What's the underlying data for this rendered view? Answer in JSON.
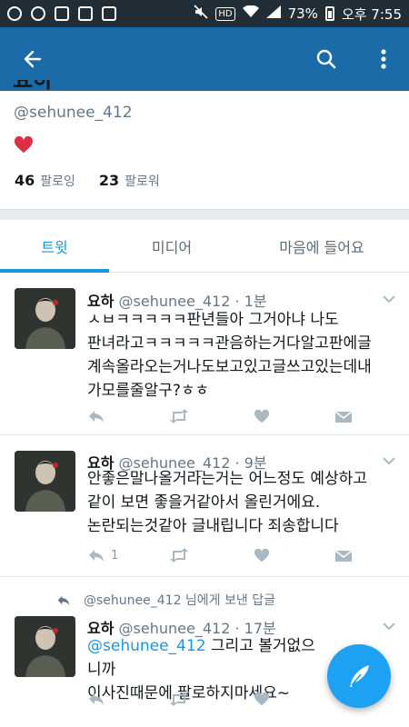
{
  "status_bar": {
    "battery": "73%",
    "time": "오후 7:55",
    "hd": "HD"
  },
  "profile": {
    "name_cut": "요하",
    "handle": "@sehunee_412",
    "following_count": "46",
    "following_label": "팔로잉",
    "followers_count": "23",
    "followers_label": "팔로워"
  },
  "tabs": [
    {
      "label": "트윗",
      "active": true
    },
    {
      "label": "미디어",
      "active": false
    },
    {
      "label": "마음에 들어요",
      "active": false
    }
  ],
  "tweets": [
    {
      "name": "요하",
      "meta": "@sehunee_412 · 1분",
      "lines": [
        "ㅅㅂㅋㅋㅋㅋㅋ판년들아 그거아냐 나도",
        "판녀라고ㅋㅋㅋㅋㅋ관음하는거다알고판에글",
        "계속올라오는거나도보고있고글쓰고있는데내",
        "가모를줄알구?ㅎㅎ"
      ],
      "reply_count": ""
    },
    {
      "name": "요하",
      "meta": "@sehunee_412 · 9분",
      "lines": [
        "안좋은말나올거라는거는 어느정도 예상하고",
        "같이 보면 좋을거같아서 올린거에요.",
        "논란되는것같아 글내립니다 죄송합니다"
      ],
      "reply_count": "1"
    },
    {
      "reply_context": "@sehunee_412 님에게 보낸 답글",
      "name": "요하",
      "meta": "@sehunee_412 · 17분",
      "mention": "@sehunee_412",
      "line1_rest": " 그리고 볼거없으니까",
      "line2": "이사진때문에 팔로하지마세요~",
      "reply_count": ""
    }
  ],
  "colors": {
    "toolbar": "#1b6ba8",
    "accent": "#1b95e0",
    "status_bar": "#222d36"
  }
}
